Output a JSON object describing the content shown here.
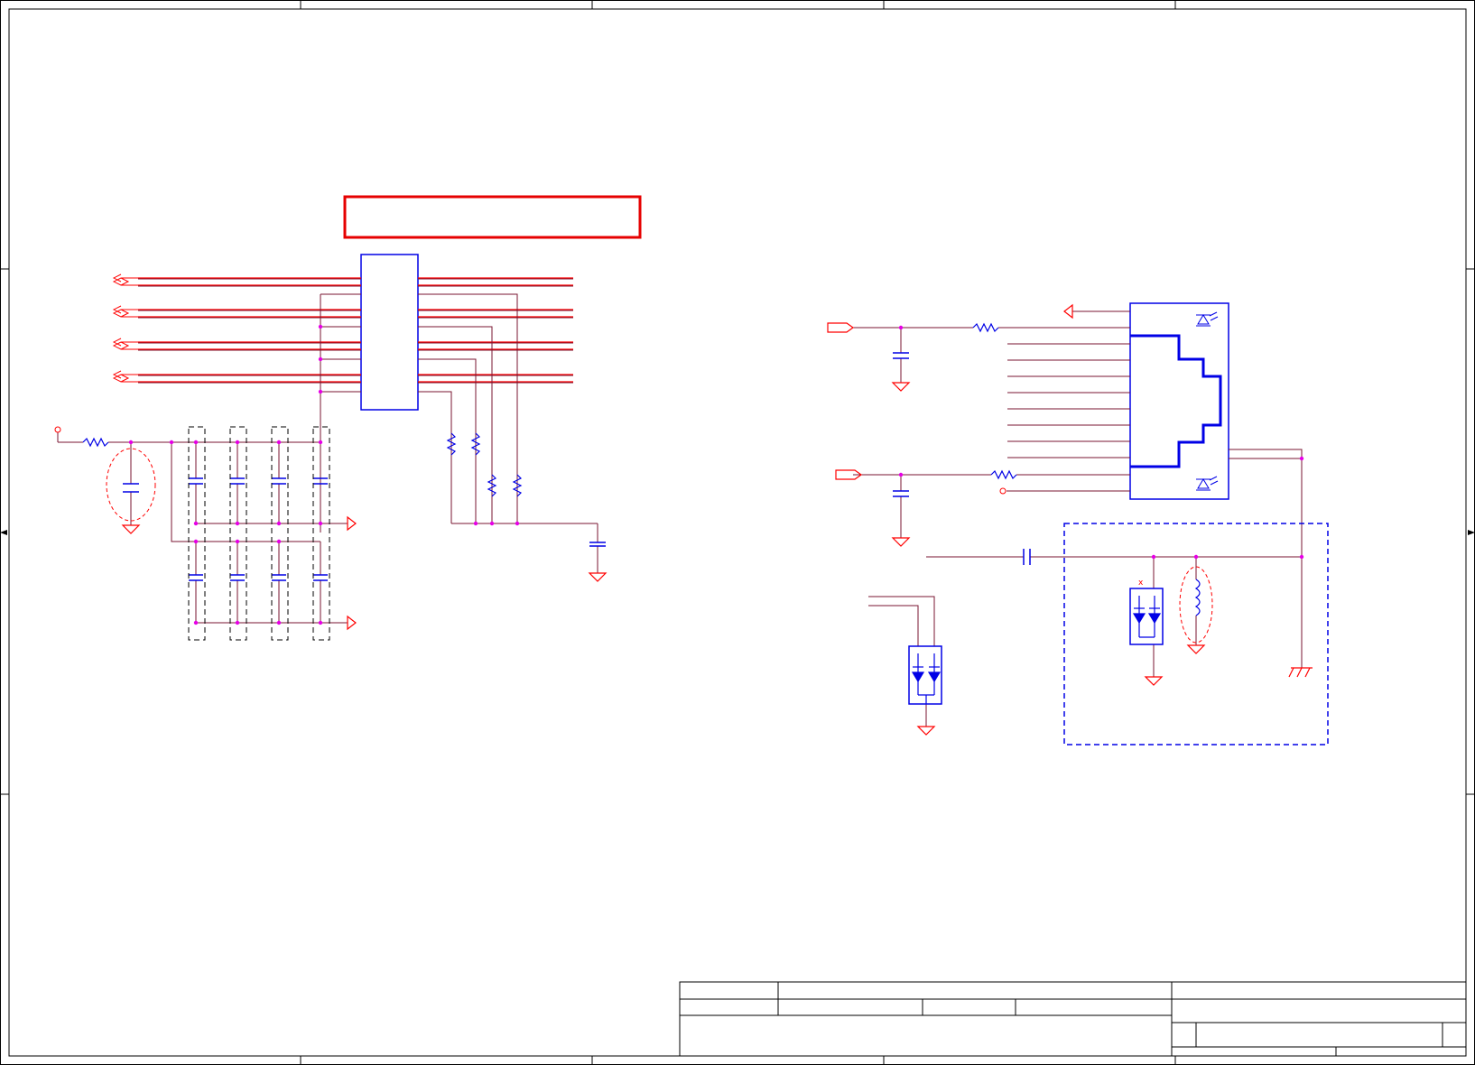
{
  "colors": {
    "frame": "#000000",
    "wire": "#7a1630",
    "net": "#ff0000",
    "part": "#0000e6",
    "junction": "#e600e6",
    "highlight_box": "#e60000"
  },
  "symbols": [
    "transformer-module",
    "resistor",
    "capacitor",
    "inductor",
    "tvs-diode-array",
    "ground",
    "chassis-ground",
    "rj45-connector",
    "status-led",
    "differential-port"
  ]
}
